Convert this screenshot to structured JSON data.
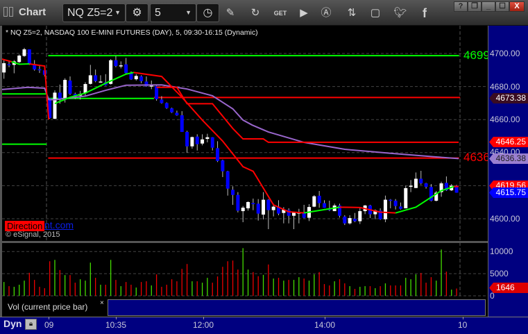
{
  "window": {
    "title": "Chart",
    "buttons": {
      "help": "?",
      "restore": "❐",
      "minimize": "_",
      "maximize": "☐",
      "close": "X"
    }
  },
  "toolbar": {
    "symbol": "NQ Z5=2",
    "interval": "5",
    "get_label": "GET",
    "icons": [
      "gear-icon",
      "clock-icon",
      "pencil-icon",
      "chart-refresh-icon",
      "get-icon",
      "play-icon",
      "alert-icon",
      "swap-icon",
      "comment-icon",
      "twitter-icon",
      "facebook-icon"
    ]
  },
  "info_line": "* NQ Z5=2, NASDAQ 100 E-MINI FUTURES (DAY), 5, 09:30-16:15 (Dynamic)",
  "watermark": {
    "brand": "Direction",
    "suffix": "nt.com",
    "copyright": "© eSignal, 2015"
  },
  "volume_pane": {
    "label": "Vol (current price bar)",
    "close": "×",
    "last_value": "1646",
    "axis_ticks": [
      "10000",
      "5000",
      "0"
    ]
  },
  "time_axis": {
    "mode": "Dyn",
    "labels": [
      "09",
      "10:35",
      "12:00",
      "14:00",
      "10"
    ]
  },
  "colors": {
    "up_candle": "#ffffff",
    "down_candle": "#0000ff",
    "vol_up": "#44dd00",
    "vol_down": "#ee0000",
    "axis_bg": "#000080",
    "ma_green": "#00ff00",
    "ma_red": "#ff0000",
    "ma_purple": "#9966cc"
  },
  "chart_data": {
    "type": "candlestick",
    "symbol": "NQ Z5=2",
    "ylim": [
      4592,
      4706
    ],
    "y_ticks": [
      "4700.00",
      "4680.00",
      "4660.00",
      "4640.00",
      "4600.00"
    ],
    "price_tags": [
      {
        "value": "4673.38",
        "color": "#3a0c22",
        "text_color": "#ffffff"
      },
      {
        "value": "4646.25",
        "color": "#ff0000",
        "text_color": "#ffffff"
      },
      {
        "value": "4636.38",
        "color": "#9a7fd0",
        "text_color": "#202020"
      },
      {
        "value": "4619.56",
        "color": "#ff0000",
        "text_color": "#ffffff"
      },
      {
        "value": "4615.75",
        "color": "#0000ff",
        "text_color": "#ffffff"
      }
    ],
    "level_labels": [
      {
        "text": "4699",
        "color": "#00ff00"
      },
      {
        "text": "4636",
        "color": "#ff0000"
      }
    ],
    "candles": [
      [
        4688.5,
        4695.9,
        4684.7,
        4694.1
      ],
      [
        4693.5,
        4695.2,
        4691.7,
        4693.0
      ],
      [
        4693.1,
        4696.0,
        4688.0,
        4695.2
      ],
      [
        4694.8,
        4699.4,
        4694.3,
        4698.7
      ],
      [
        4698.5,
        4703.4,
        4698.0,
        4702.5
      ],
      [
        4702.5,
        4702.5,
        4693.1,
        4693.7
      ],
      [
        4693.3,
        4696.0,
        4689.6,
        4690.3
      ],
      [
        4690.5,
        4692.4,
        4688.2,
        4689.8
      ],
      [
        4689.8,
        4692.4,
        4686.1,
        4687.1
      ],
      [
        4672.8,
        4673.0,
        4660.5,
        4660.9
      ],
      [
        4660.5,
        4677.7,
        4660.2,
        4676.3
      ],
      [
        4676.3,
        4681.2,
        4669.6,
        4672.1
      ],
      [
        4672.4,
        4685.0,
        4670.3,
        4684.0
      ],
      [
        4683.6,
        4686.1,
        4674.9,
        4675.6
      ],
      [
        4675.5,
        4676.3,
        4672.4,
        4673.9
      ],
      [
        4674.5,
        4677.4,
        4672.1,
        4675.5
      ],
      [
        4676.0,
        4682.6,
        4674.6,
        4681.5
      ],
      [
        4681.6,
        4693.1,
        4681.2,
        4686.8
      ],
      [
        4686.8,
        4690.3,
        4682.6,
        4683.3
      ],
      [
        4682.5,
        4686.8,
        4682.5,
        4683.0
      ],
      [
        4682.6,
        4687.5,
        4680.5,
        4680.8
      ],
      [
        4681.6,
        4696.6,
        4681.2,
        4695.9
      ],
      [
        4695.9,
        4698.5,
        4691.7,
        4692.4
      ],
      [
        4692.4,
        4695.2,
        4691.0,
        4692.8
      ],
      [
        4693.4,
        4697.3,
        4687.5,
        4688.2
      ],
      [
        4688.1,
        4689.2,
        4684.0,
        4684.3
      ],
      [
        4684.4,
        4687.5,
        4683.6,
        4686.4
      ],
      [
        4686.1,
        4686.8,
        4682.0,
        4683.3
      ],
      [
        4683.0,
        4686.1,
        4679.8,
        4680.2
      ],
      [
        4680.2,
        4683.6,
        4678.4,
        4680.6
      ],
      [
        4680.2,
        4680.5,
        4671.4,
        4672.4
      ],
      [
        4672.1,
        4674.2,
        4669.6,
        4670.0
      ],
      [
        4670.0,
        4670.4,
        4666.5,
        4667.0
      ],
      [
        4666.8,
        4667.2,
        4664.0,
        4664.4
      ],
      [
        4664.1,
        4665.4,
        4662.3,
        4662.6
      ],
      [
        4662.6,
        4665.1,
        4652.5,
        4652.5
      ],
      [
        4652.5,
        4653.2,
        4639.9,
        4643.8
      ],
      [
        4643.8,
        4649.7,
        4642.4,
        4649.4
      ],
      [
        4649.7,
        4651.1,
        4641.3,
        4645.1
      ],
      [
        4645.5,
        4651.1,
        4644.4,
        4648.0
      ],
      [
        4648.3,
        4651.4,
        4646.2,
        4649.3
      ],
      [
        4649.3,
        4649.4,
        4641.3,
        4643.0
      ],
      [
        4642.7,
        4646.9,
        4634.3,
        4635.0
      ],
      [
        4635.3,
        4635.7,
        4625.2,
        4628.7
      ],
      [
        4628.7,
        4629.0,
        4614.0,
        4618.2
      ],
      [
        4617.5,
        4619.6,
        4608.4,
        4614.4
      ],
      [
        4614.4,
        4616.1,
        4603.8,
        4604.9
      ],
      [
        4604.6,
        4607.7,
        4597.9,
        4606.7
      ],
      [
        4606.3,
        4610.5,
        4604.9,
        4610.1
      ],
      [
        4609.5,
        4612.2,
        4605.2,
        4608.8
      ],
      [
        4609.1,
        4611.9,
        4598.9,
        4603.1
      ],
      [
        4602.5,
        4616.1,
        4599.6,
        4611.5
      ],
      [
        4611.5,
        4611.9,
        4593.7,
        4605.2
      ],
      [
        4605.2,
        4609.1,
        4601.4,
        4607.3
      ],
      [
        4607.3,
        4611.2,
        4602.1,
        4603.1
      ],
      [
        4603.5,
        4607.0,
        4597.2,
        4605.5
      ],
      [
        4605.3,
        4606.3,
        4597.2,
        4601.8
      ],
      [
        4601.8,
        4604.2,
        4593.7,
        4603.8
      ],
      [
        4603.1,
        4606.0,
        4597.2,
        4603.9
      ],
      [
        4603.8,
        4608.4,
        4600.3,
        4600.6
      ],
      [
        4600.6,
        4608.8,
        4598.6,
        4607.1
      ],
      [
        4607.3,
        4614.3,
        4607.0,
        4613.6
      ],
      [
        4613.9,
        4616.8,
        4606.7,
        4609.4
      ],
      [
        4609.4,
        4611.2,
        4606.6,
        4606.7
      ],
      [
        4606.3,
        4610.9,
        4604.6,
        4605.2
      ],
      [
        4604.6,
        4609.1,
        4604.6,
        4608.0
      ],
      [
        4608.0,
        4609.1,
        4600.7,
        4601.8
      ],
      [
        4601.3,
        4602.1,
        4596.2,
        4597.2
      ],
      [
        4597.2,
        4602.1,
        4596.5,
        4600.4
      ],
      [
        4600.0,
        4603.5,
        4597.9,
        4598.5
      ],
      [
        4598.5,
        4606.3,
        4596.8,
        4604.6
      ],
      [
        4604.6,
        4608.4,
        4602.8,
        4608.0
      ],
      [
        4608.0,
        4608.4,
        4600.4,
        4602.7
      ],
      [
        4602.7,
        4605.6,
        4599.7,
        4605.1
      ],
      [
        4604.9,
        4606.3,
        4599.3,
        4599.7
      ],
      [
        4599.7,
        4614.0,
        4597.9,
        4611.5
      ],
      [
        4611.5,
        4611.9,
        4606.3,
        4610.8
      ],
      [
        4610.9,
        4611.9,
        4605.6,
        4607.7
      ],
      [
        4607.4,
        4609.8,
        4605.6,
        4606.0
      ],
      [
        4606.3,
        4620.0,
        4606.3,
        4618.5
      ],
      [
        4619.3,
        4623.4,
        4616.1,
        4620.0
      ],
      [
        4618.6,
        4628.0,
        4618.6,
        4624.2
      ],
      [
        4624.2,
        4629.0,
        4620.6,
        4621.4
      ],
      [
        4621.4,
        4621.7,
        4618.2,
        4619.3
      ],
      [
        4619.2,
        4621.0,
        4610.5,
        4610.9
      ],
      [
        4610.9,
        4616.8,
        4610.5,
        4615.8
      ],
      [
        4616.1,
        4622.4,
        4613.3,
        4621.4
      ],
      [
        4621.7,
        4625.6,
        4616.8,
        4617.2
      ],
      [
        4617.2,
        4621.0,
        4616.8,
        4620.0
      ],
      [
        4620.0,
        4620.5,
        4615.7,
        4615.75
      ]
    ],
    "volume": {
      "ylim": [
        0,
        12000
      ],
      "values": [
        3120,
        2180,
        2030,
        2500,
        3430,
        5200,
        3590,
        2030,
        1720,
        7800,
        8110,
        5820,
        4680,
        4680,
        2960,
        3740,
        3430,
        7490,
        4060,
        2500,
        2500,
        8110,
        3590,
        2180,
        3120,
        2500,
        1870,
        3120,
        3280,
        2340,
        4840,
        2030,
        2500,
        3740,
        3280,
        6080,
        7180,
        3280,
        3280,
        2960,
        4060,
        2960,
        4370,
        6550,
        7800,
        7960,
        5930,
        10760,
        5930,
        5360,
        4420,
        4730,
        7070,
        3900,
        4060,
        3430,
        3590,
        3590,
        4210,
        3900,
        3430,
        4840,
        5360,
        2650,
        2340,
        3280,
        3740,
        2810,
        2180,
        1560,
        2030,
        2180,
        2180,
        1720,
        2180,
        2810,
        2340,
        2340,
        2340,
        4060,
        3740,
        4840,
        5150,
        2960,
        4210,
        3430,
        10450,
        5460,
        1400,
        1646
      ],
      "up": [
        1,
        0,
        1,
        1,
        1,
        0,
        0,
        0,
        0,
        0,
        1,
        0,
        1,
        0,
        0,
        1,
        1,
        1,
        0,
        1,
        0,
        1,
        0,
        1,
        0,
        0,
        1,
        0,
        0,
        1,
        0,
        0,
        0,
        0,
        0,
        0,
        0,
        1,
        0,
        1,
        1,
        0,
        0,
        0,
        0,
        0,
        0,
        1,
        1,
        0,
        0,
        1,
        0,
        1,
        0,
        1,
        0,
        1,
        1,
        0,
        1,
        1,
        0,
        0,
        0,
        1,
        0,
        0,
        1,
        0,
        1,
        1,
        0,
        1,
        0,
        1,
        0,
        0,
        0,
        1,
        1,
        1,
        0,
        0,
        0,
        1,
        1,
        0,
        1,
        0
      ]
    },
    "levels": [
      {
        "price": 4698.7,
        "from": 8.7,
        "to": 89.5,
        "color": "#00ff00"
      },
      {
        "price": 4672.8,
        "from": 8.7,
        "to": 29.5,
        "color": "#00ff00"
      },
      {
        "price": 4673.38,
        "from": 29.5,
        "to": 89.7,
        "color": "#ff0000"
      },
      {
        "price": 4636.7,
        "from": 8.7,
        "to": 89.5,
        "color": "#ff0000"
      },
      {
        "price": 4675.5,
        "from": -0.4,
        "to": 8.4,
        "color": "#00ff00"
      },
      {
        "price": 4673.4,
        "from": -0.4,
        "to": 8.4,
        "color": "#4a0a2a"
      },
      {
        "price": 4645.1,
        "from": -0.4,
        "to": 8.4,
        "color": "#00ff00"
      }
    ],
    "lines": [
      {
        "color": "#9966cc",
        "points": [
          [
            -0.4,
            4678.2
          ],
          [
            4.7,
            4679.5
          ],
          [
            8,
            4679
          ],
          [
            8.8,
            4672.1
          ],
          [
            10,
            4672
          ],
          [
            16,
            4674.2
          ],
          [
            20,
            4677.7
          ],
          [
            24,
            4680.8
          ],
          [
            31,
            4681
          ],
          [
            36,
            4678.5
          ],
          [
            41,
            4674.4
          ],
          [
            45,
            4666.5
          ],
          [
            47,
            4659.7
          ],
          [
            48.8,
            4656.7
          ],
          [
            52,
            4652.5
          ],
          [
            59,
            4646.2
          ],
          [
            67,
            4642
          ],
          [
            76,
            4639.6
          ],
          [
            85,
            4637.4
          ],
          [
            89.4,
            4636.38
          ]
        ]
      },
      {
        "color": "#ff0000",
        "points": [
          [
            30,
            4679.5
          ],
          [
            34,
            4679.5
          ],
          [
            36,
            4669.6
          ],
          [
            41,
            4669.6
          ],
          [
            45,
            4654.6
          ],
          [
            47,
            4648.3
          ],
          [
            51,
            4648.3
          ],
          [
            52,
            4646.25
          ],
          [
            89.4,
            4646.25
          ]
        ]
      },
      {
        "segments": [
          {
            "color": "#ff0000",
            "points": [
              [
                -0.4,
                4696.6
              ],
              [
                1.5,
                4695
              ]
            ]
          },
          {
            "color": "#00ff00",
            "points": [
              [
                1.5,
                4695
              ],
              [
                3,
                4693.5
              ],
              [
                5,
                4693.7
              ]
            ]
          },
          {
            "color": "#ff0000",
            "points": [
              [
                5,
                4693.7
              ],
              [
                8,
                4692.4
              ],
              [
                8.8,
                4660
              ]
            ]
          },
          {
            "color": "#00ff00",
            "points": [
              [
                10,
                4669.7
              ],
              [
                13,
                4673.5
              ],
              [
                16,
                4676
              ],
              [
                20,
                4682
              ],
              [
                24,
                4687.5
              ],
              [
                25.5,
                4688.5
              ]
            ]
          },
          {
            "color": "#ff0000",
            "points": [
              [
                25.5,
                4688.5
              ],
              [
                31,
                4686.1
              ],
              [
                35,
                4673.5
              ],
              [
                39,
                4659.7
              ],
              [
                43,
                4647
              ],
              [
                47,
                4631.5
              ],
              [
                49,
                4628.7
              ],
              [
                53,
                4608.4
              ],
              [
                56,
                4604.2
              ],
              [
                59,
                4603.5
              ]
            ]
          },
          {
            "color": "#00ff00",
            "points": [
              [
                59,
                4603.5
              ],
              [
                63,
                4605.5
              ],
              [
                66,
                4607
              ]
            ]
          },
          {
            "color": "#ff0000",
            "points": [
              [
                66,
                4607
              ],
              [
                70,
                4606.8
              ],
              [
                74,
                4604
              ],
              [
                77,
                4603.5
              ]
            ]
          },
          {
            "color": "#00ff00",
            "points": [
              [
                77,
                4603.5
              ],
              [
                81,
                4607
              ],
              [
                86,
                4617
              ],
              [
                88.5,
                4619.5
              ]
            ]
          },
          {
            "color": "#ff0000",
            "points": [
              [
                88.5,
                4619.5
              ],
              [
                89.4,
                4619.56
              ]
            ]
          }
        ]
      }
    ]
  }
}
